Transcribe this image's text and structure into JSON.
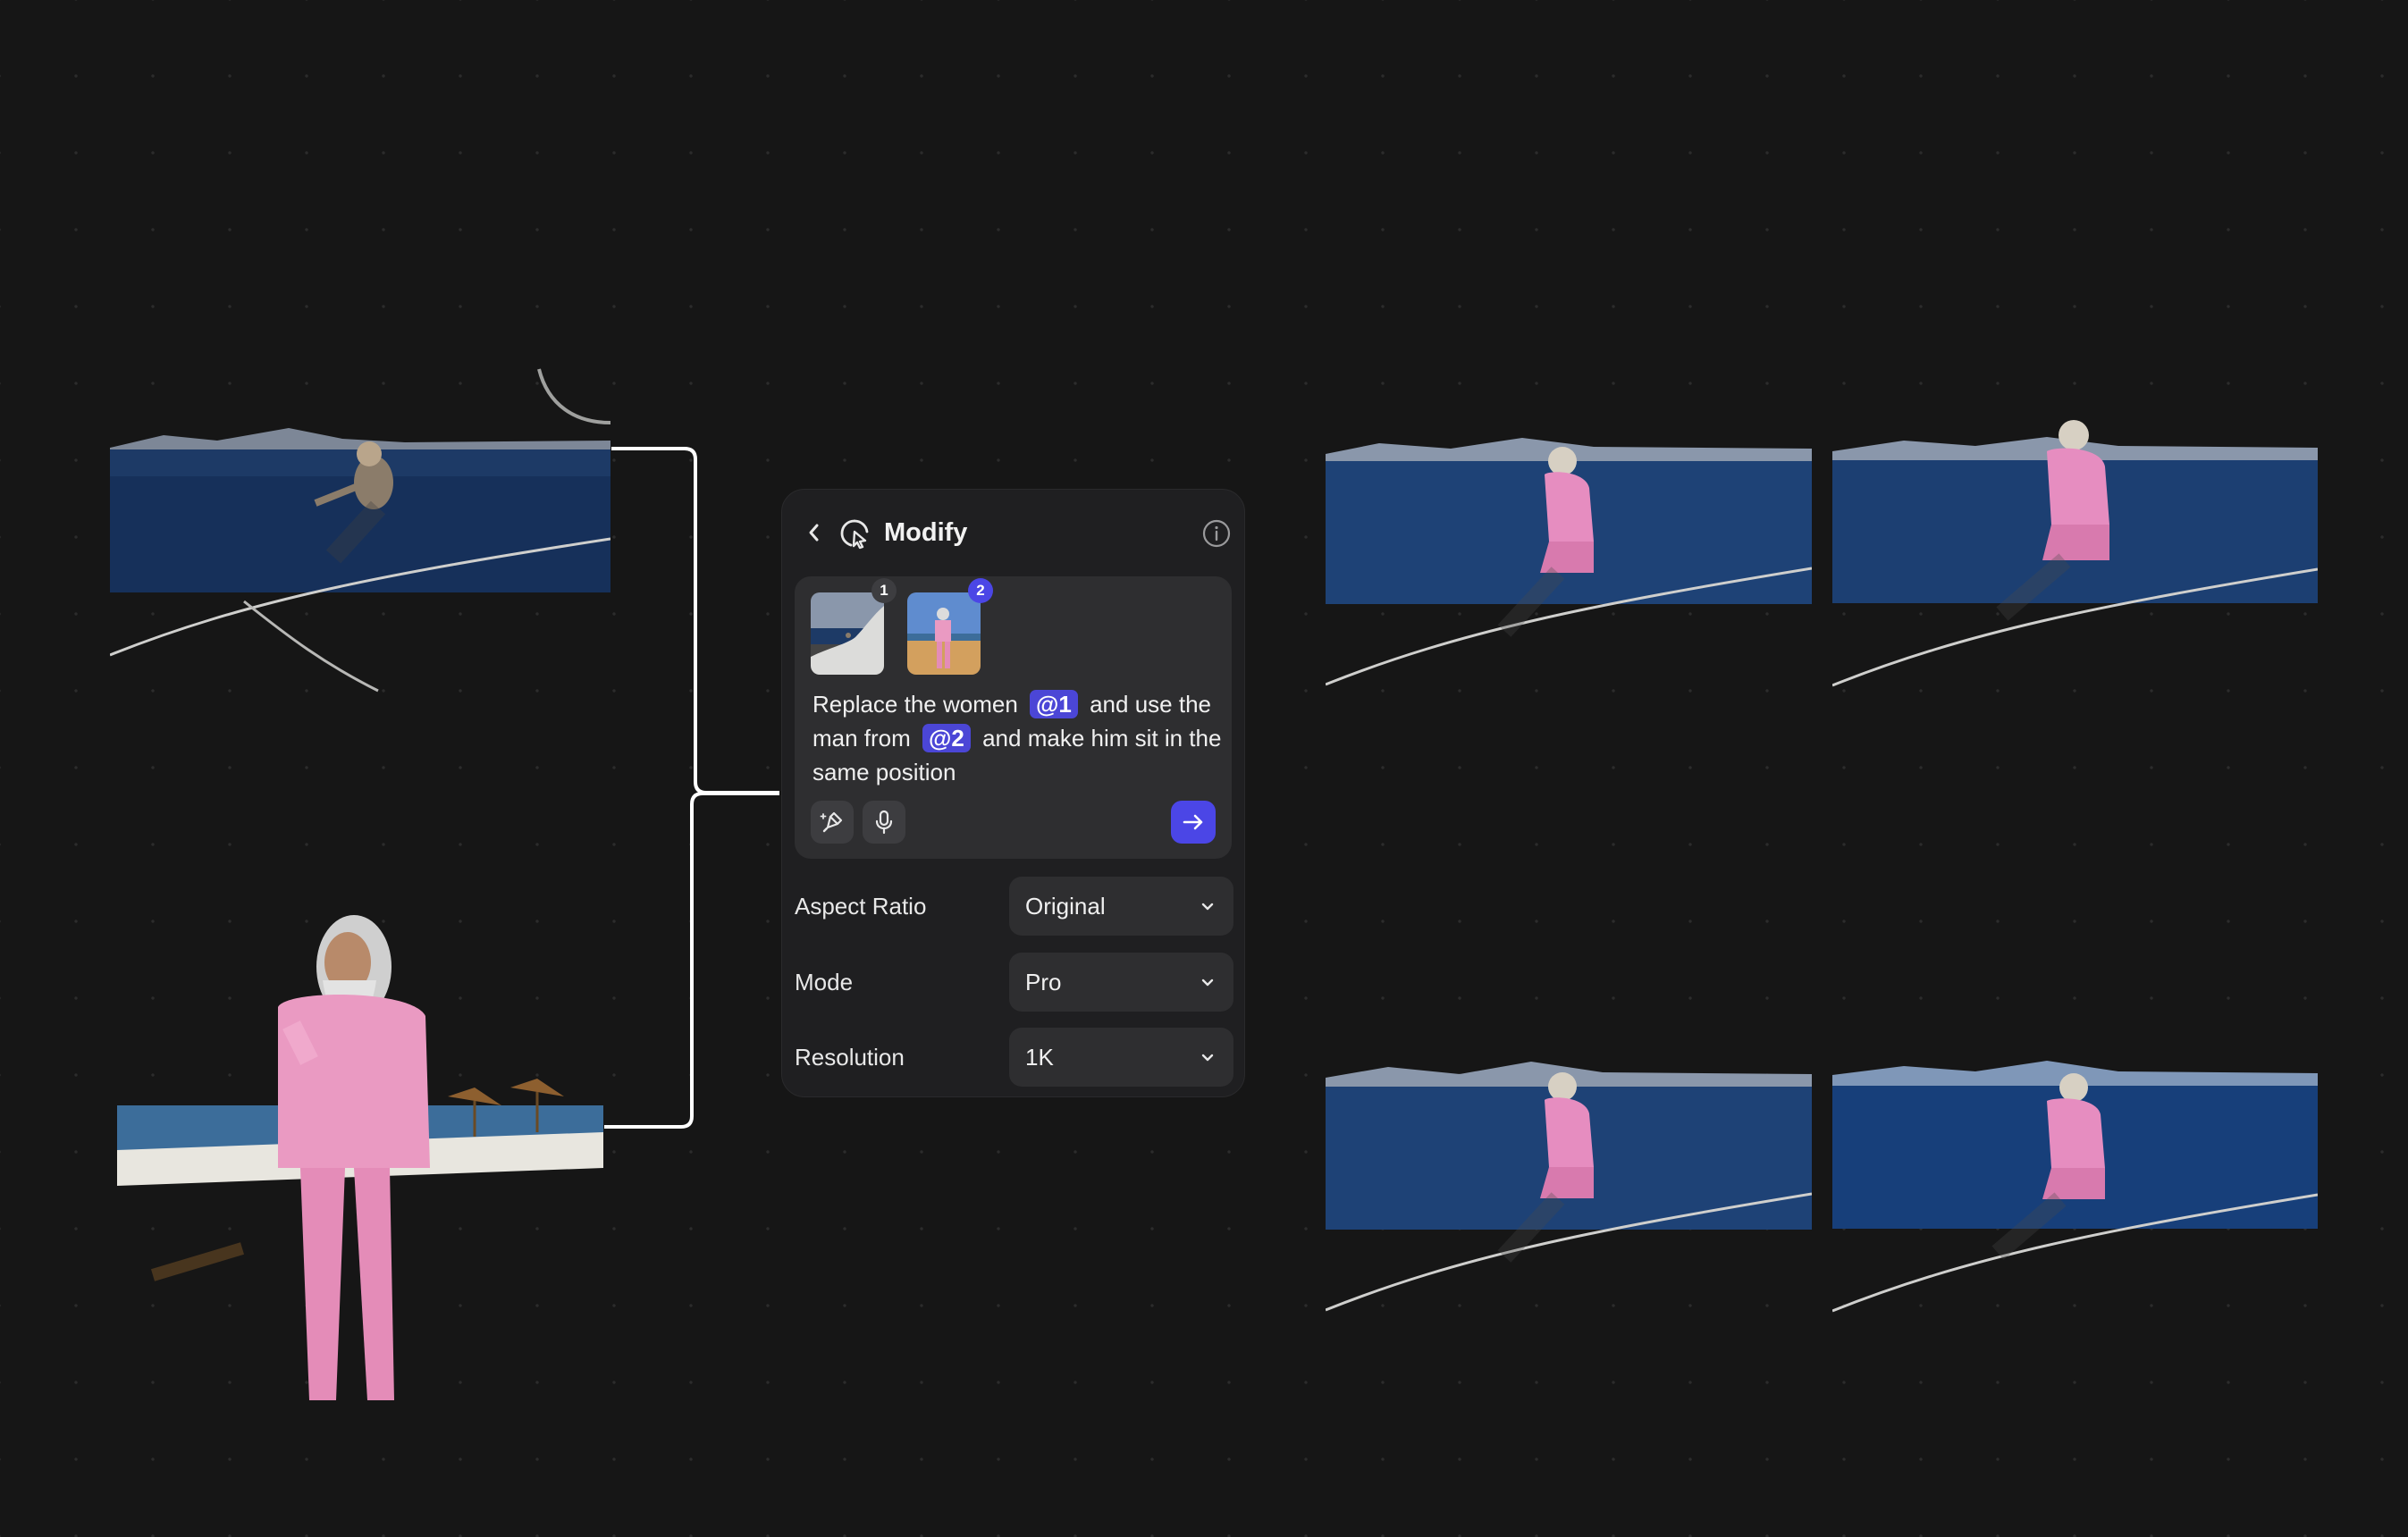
{
  "panel": {
    "title": "Modify",
    "back_icon": "chevron-left-icon",
    "tool_icon": "modify-cursor-icon",
    "info_icon": "info-icon",
    "reference_badges": [
      "1",
      "2"
    ],
    "prompt": {
      "part1": "Replace the women",
      "tag1": "@1",
      "part2": "and use the man from",
      "tag2": "@2",
      "part3": "and make him sit in the same position"
    },
    "actions": {
      "enhance_icon": "magic-pen-icon",
      "mic_icon": "microphone-icon",
      "send_icon": "arrow-right-icon"
    },
    "settings": [
      {
        "label": "Aspect Ratio",
        "value": "Original"
      },
      {
        "label": "Mode",
        "value": "Pro"
      },
      {
        "label": "Resolution",
        "value": "1K"
      }
    ]
  },
  "colors": {
    "background": "#161616",
    "panel": "#1f1f21",
    "accent": "#4b46e6",
    "tag": "#4b46d6"
  }
}
